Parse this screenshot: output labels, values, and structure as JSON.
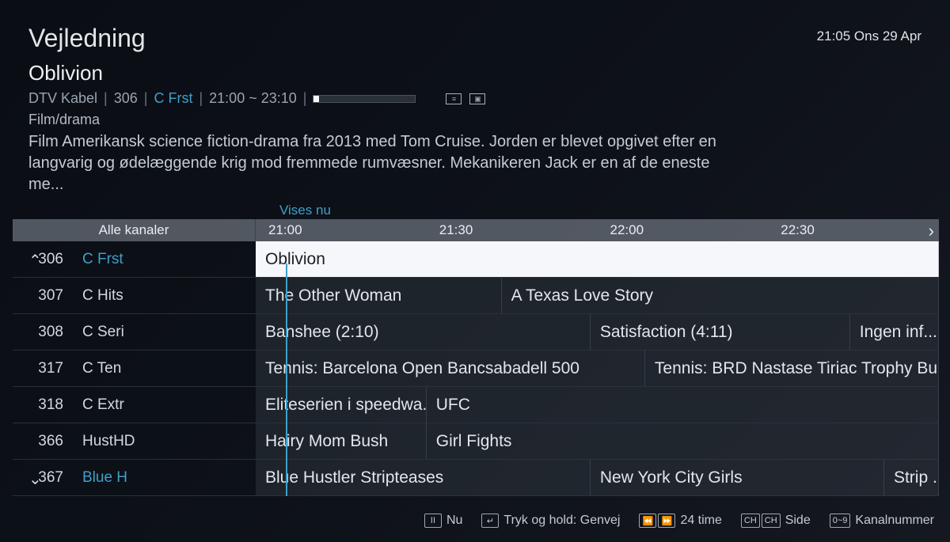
{
  "header": {
    "title": "Vejledning",
    "datetime": "21:05 Ons 29 Apr"
  },
  "program": {
    "title": "Oblivion",
    "source": "DTV Kabel",
    "channel_num": "306",
    "channel_name": "C Frst",
    "time_range": "21:00 ~ 23:10",
    "genre": "Film/drama",
    "description": "Film Amerikansk science fiction-drama fra 2013 med Tom Cruise.  Jorden er blevet opgivet efter en langvarig og ødelæggende krig mod fremmede rumvæsner. Mekanikeren Jack er en af de eneste me..."
  },
  "now_label": "Vises nu",
  "channel_header": "Alle kanaler",
  "time_slots": [
    "21:00",
    "21:30",
    "22:00",
    "22:30"
  ],
  "channels": [
    {
      "num": "306",
      "name": "C Frst"
    },
    {
      "num": "307",
      "name": "C Hits"
    },
    {
      "num": "308",
      "name": "C Seri"
    },
    {
      "num": "317",
      "name": "C Ten"
    },
    {
      "num": "318",
      "name": "C Extr"
    },
    {
      "num": "366",
      "name": "HustHD"
    },
    {
      "num": "367",
      "name": "Blue H"
    }
  ],
  "programs": {
    "r0": [
      {
        "title": "Oblivion",
        "width": "100%"
      }
    ],
    "r1": [
      {
        "title": "The Other Woman",
        "width": "36%"
      },
      {
        "title": "A Texas Love Story",
        "width": "64%"
      }
    ],
    "r2": [
      {
        "title": "Banshee (2:10)",
        "width": "49%"
      },
      {
        "title": "Satisfaction (4:11)",
        "width": "38%"
      },
      {
        "title": "Ingen inf...",
        "width": "13%"
      }
    ],
    "r3": [
      {
        "title": "Tennis: Barcelona Open Bancsabadell 500",
        "width": "57%"
      },
      {
        "title": "Tennis: BRD Nastase Tiriac Trophy Bu...",
        "width": "43%"
      }
    ],
    "r4": [
      {
        "title": "Eliteserien i speedwa...",
        "width": "25%"
      },
      {
        "title": "UFC",
        "width": "75%"
      }
    ],
    "r5": [
      {
        "title": "Hairy Mom Bush",
        "width": "25%"
      },
      {
        "title": "Girl Fights",
        "width": "75%"
      }
    ],
    "r6": [
      {
        "title": "Blue Hustler Stripteases",
        "width": "49%"
      },
      {
        "title": "New York City Girls",
        "width": "43%"
      },
      {
        "title": "Strip ...",
        "width": "8%"
      }
    ]
  },
  "footer": {
    "nu": "Nu",
    "shortcut": "Tryk og hold: Genvej",
    "hours": "24 time",
    "page": "Side",
    "channel_num": "Kanalnummer"
  }
}
